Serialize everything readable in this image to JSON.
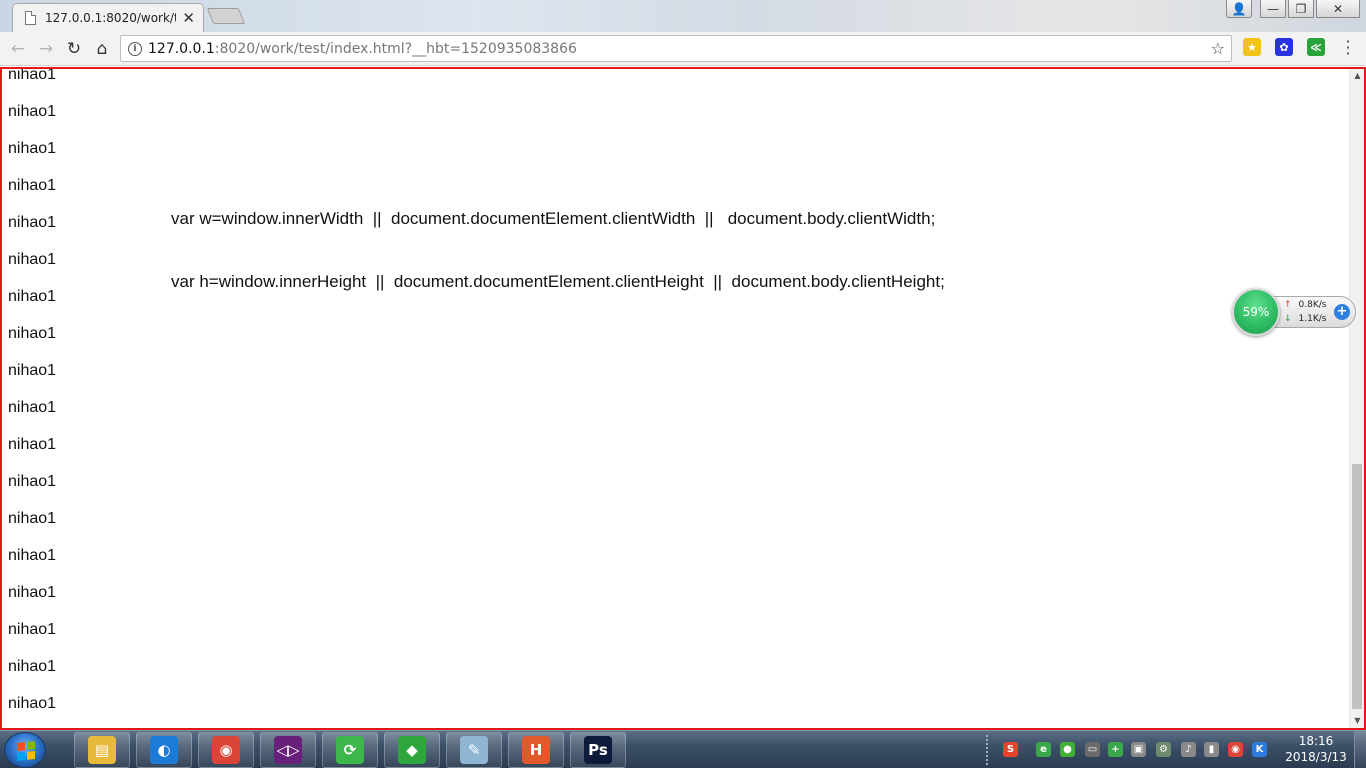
{
  "browser": {
    "tab": {
      "title": "127.0.0.1:8020/work/test/index.html?__hbt=1520935083866",
      "close": "✕"
    },
    "window_controls": {
      "user": "👤",
      "minimize": "—",
      "restore": "❐",
      "close": "✕"
    },
    "toolbar": {
      "back": "←",
      "forward": "→",
      "reload": "↻",
      "home": "⌂",
      "url_host": "127.0.0.1",
      "url_rest": ":8020/work/test/index.html?__hbt=1520935083866",
      "bookmark_star": "☆",
      "menu": "⋮"
    },
    "extensions": [
      {
        "name": "extension-1",
        "color": "#f2c31b",
        "glyph": "★"
      },
      {
        "name": "baidu-paw-extension",
        "color": "#2932e1",
        "glyph": "✿"
      },
      {
        "name": "share-extension",
        "color": "#27a33a",
        "glyph": "≪"
      }
    ]
  },
  "page": {
    "lines": [
      "nihao1",
      "nihao1",
      "nihao1",
      "nihao1",
      "nihao1",
      "nihao1",
      "nihao1",
      "nihao1",
      "nihao1",
      "nihao1",
      "nihao1",
      "nihao1",
      "nihao1",
      "nihao1",
      "nihao1",
      "nihao1",
      "nihao1",
      "nihao1"
    ],
    "code_w": "var w=window.innerWidth  ||  document.documentElement.clientWidth  ||   document.body.clientWidth;",
    "code_h": "var h=window.innerHeight  ||  document.documentElement.clientHeight  ||  document.body.clientHeight;"
  },
  "net_widget": {
    "percent": "59%",
    "upload": "0.8K/s",
    "download": "1.1K/s",
    "up_arrow": "↑",
    "down_arrow": "↓",
    "plus": "+"
  },
  "taskbar": {
    "apps": [
      {
        "name": "file-explorer",
        "color": "#e8b93a",
        "glyph": "▤"
      },
      {
        "name": "qq-browser",
        "color": "#1d7bd8",
        "glyph": "◐"
      },
      {
        "name": "chrome",
        "color": "#db4437",
        "glyph": "◉"
      },
      {
        "name": "visual-studio",
        "color": "#68217a",
        "glyph": "◁▷"
      },
      {
        "name": "sync-app",
        "color": "#3cb84a",
        "glyph": "⟳"
      },
      {
        "name": "green-app",
        "color": "#2ea63c",
        "glyph": "◆"
      },
      {
        "name": "notepad-app",
        "color": "#8fb7d3",
        "glyph": "✎"
      },
      {
        "name": "hbuilder",
        "color": "#e25a2c",
        "glyph": "H"
      },
      {
        "name": "photoshop",
        "color": "#0f1b3a",
        "glyph": "Ps"
      }
    ],
    "tray": [
      {
        "name": "sogou-input",
        "color": "#e5432e",
        "glyph": "S"
      },
      {
        "name": "tray-360",
        "color": "#3aa84a",
        "glyph": "e"
      },
      {
        "name": "wechat",
        "color": "#41b035",
        "glyph": "●"
      },
      {
        "name": "tray-monitor",
        "color": "#6a6a6a",
        "glyph": "▭"
      },
      {
        "name": "tray-plus",
        "color": "#3aa84a",
        "glyph": "+"
      },
      {
        "name": "tray-clipboard",
        "color": "#8a8a8a",
        "glyph": "▣"
      },
      {
        "name": "tray-network-device",
        "color": "#6f8b6f",
        "glyph": "⚙"
      },
      {
        "name": "volume",
        "color": "#8a8a8a",
        "glyph": "♪"
      },
      {
        "name": "signal",
        "color": "#8a8a8a",
        "glyph": "▮"
      },
      {
        "name": "tray-chrome",
        "color": "#db4437",
        "glyph": "◉"
      },
      {
        "name": "tray-k",
        "color": "#2b7be0",
        "glyph": "K"
      }
    ],
    "time": "18:16",
    "date": "2018/3/13"
  }
}
